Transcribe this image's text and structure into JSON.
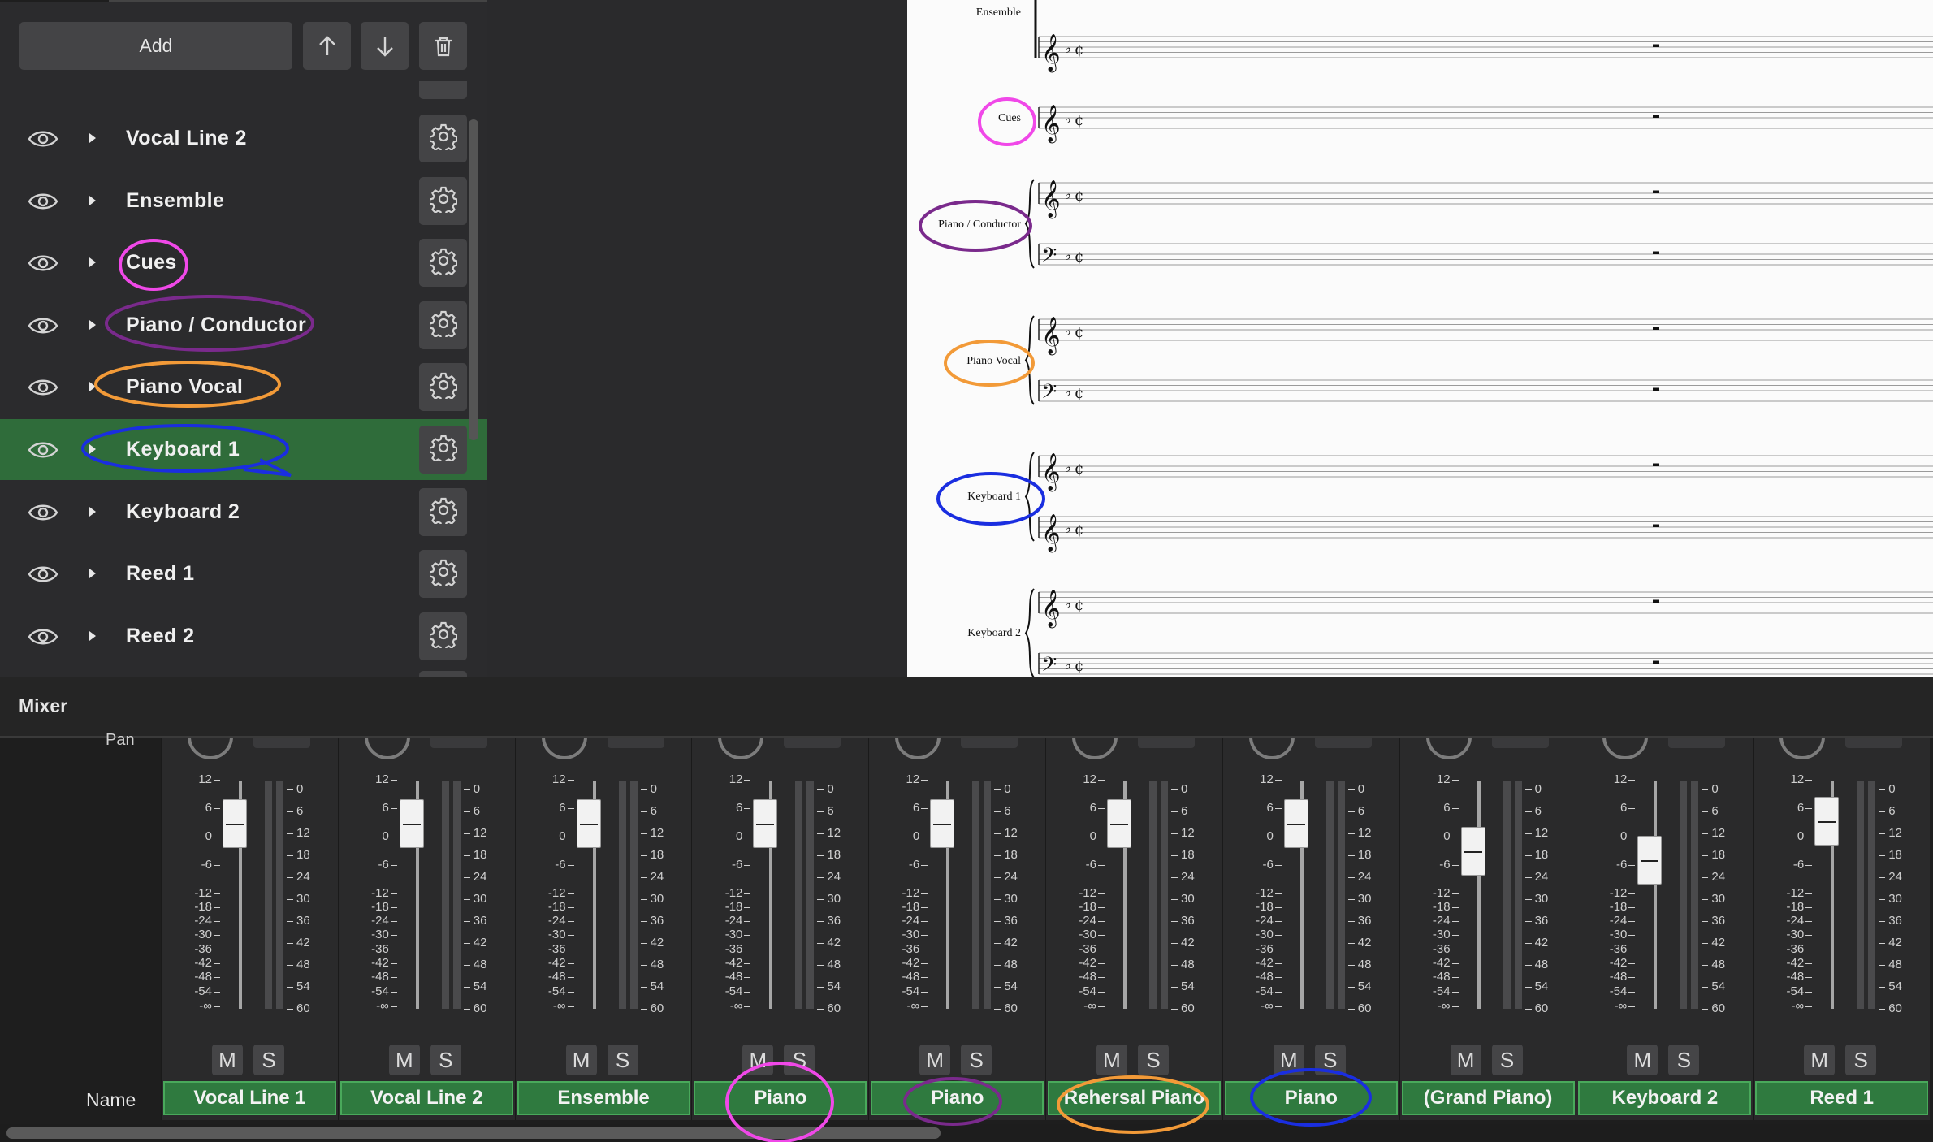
{
  "instrument_panel": {
    "add_label": "Add",
    "toolbar_icons": [
      "arrow-up-icon",
      "arrow-down-icon",
      "trash-icon"
    ],
    "instruments": [
      {
        "name": "Vocal Line 2",
        "selected": false
      },
      {
        "name": "Ensemble",
        "selected": false
      },
      {
        "name": "Cues",
        "selected": false
      },
      {
        "name": "Piano / Conductor",
        "selected": false
      },
      {
        "name": "Piano Vocal",
        "selected": false
      },
      {
        "name": "Keyboard 1",
        "selected": true
      },
      {
        "name": "Keyboard 2",
        "selected": false
      },
      {
        "name": "Reed 1",
        "selected": false
      },
      {
        "name": "Reed 2",
        "selected": false
      }
    ]
  },
  "score": {
    "staves": [
      {
        "label": "Ensemble"
      },
      {
        "label": "Cues"
      },
      {
        "label": "Piano / Conductor"
      },
      {
        "label": "Piano Vocal"
      },
      {
        "label": "Keyboard 1"
      },
      {
        "label": "Keyboard 2"
      }
    ]
  },
  "mixer": {
    "title": "Mixer",
    "pan_label": "Pan",
    "name_label": "Name",
    "mute_label": "M",
    "solo_label": "S",
    "left_scale": [
      "12",
      "6",
      "0",
      "-6",
      "-12",
      "-18",
      "-24",
      "-30",
      "-36",
      "-42",
      "-48",
      "-54",
      "-∞"
    ],
    "right_scale": [
      "0",
      "6",
      "12",
      "18",
      "24",
      "30",
      "36",
      "42",
      "48",
      "54",
      "60"
    ],
    "channels": [
      {
        "name": "Vocal Line 1",
        "fader_db": 0
      },
      {
        "name": "Vocal Line 2",
        "fader_db": 0
      },
      {
        "name": "Ensemble",
        "fader_db": 0
      },
      {
        "name": "Piano",
        "fader_db": 0
      },
      {
        "name": "Piano",
        "fader_db": 0
      },
      {
        "name": "Rehersal Piano",
        "fader_db": 0
      },
      {
        "name": "Piano",
        "fader_db": 0
      },
      {
        "name": "(Grand Piano)",
        "fader_db": -6
      },
      {
        "name": "Keyboard 2",
        "fader_db": -8
      },
      {
        "name": "Reed 1",
        "fader_db": 0.5
      }
    ]
  },
  "annotation_colors": {
    "magenta": "#f048e8",
    "purple": "#7a2a8c",
    "orange": "#f29a38",
    "blue": "#1a2ee0"
  }
}
